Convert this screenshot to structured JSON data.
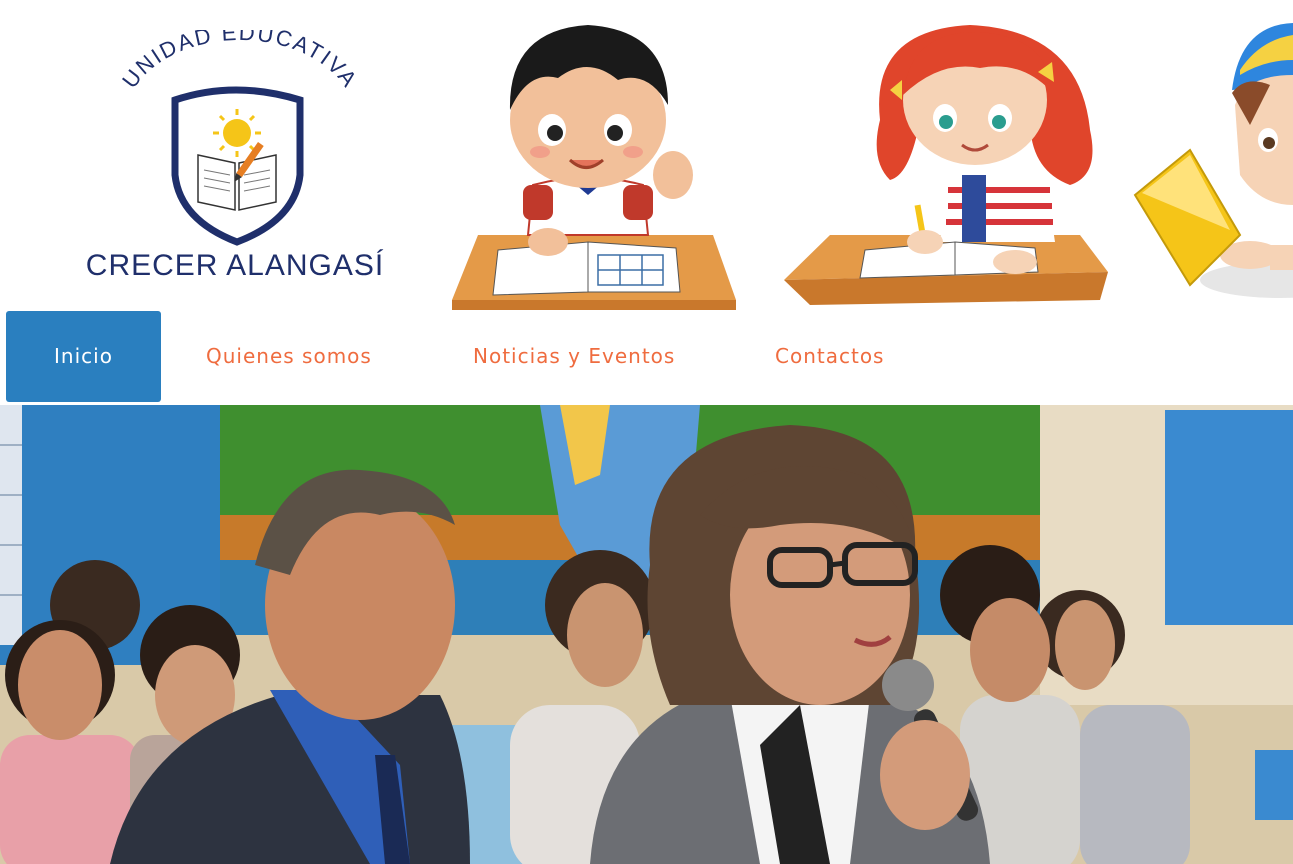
{
  "logo": {
    "arc_text": "UNIDAD EDUCATIVA",
    "name": "CRECER ALANGASÍ"
  },
  "header_images": [
    {
      "icon": "boy-writing-icon"
    },
    {
      "icon": "girl-writing-icon"
    },
    {
      "icon": "boy-reading-icon"
    }
  ],
  "nav": {
    "items": [
      {
        "label": "Inicio",
        "active": true
      },
      {
        "label": "Quienes somos",
        "active": false
      },
      {
        "label": "Noticias y Eventos",
        "active": false
      },
      {
        "label": "Contactos",
        "active": false
      }
    ]
  },
  "colors": {
    "brand_navy": "#1f2f6b",
    "nav_active_bg": "#2a7fbf",
    "nav_link": "#ef6c3f"
  },
  "hero": {
    "icon": "event-photo",
    "description_hidden": ""
  }
}
